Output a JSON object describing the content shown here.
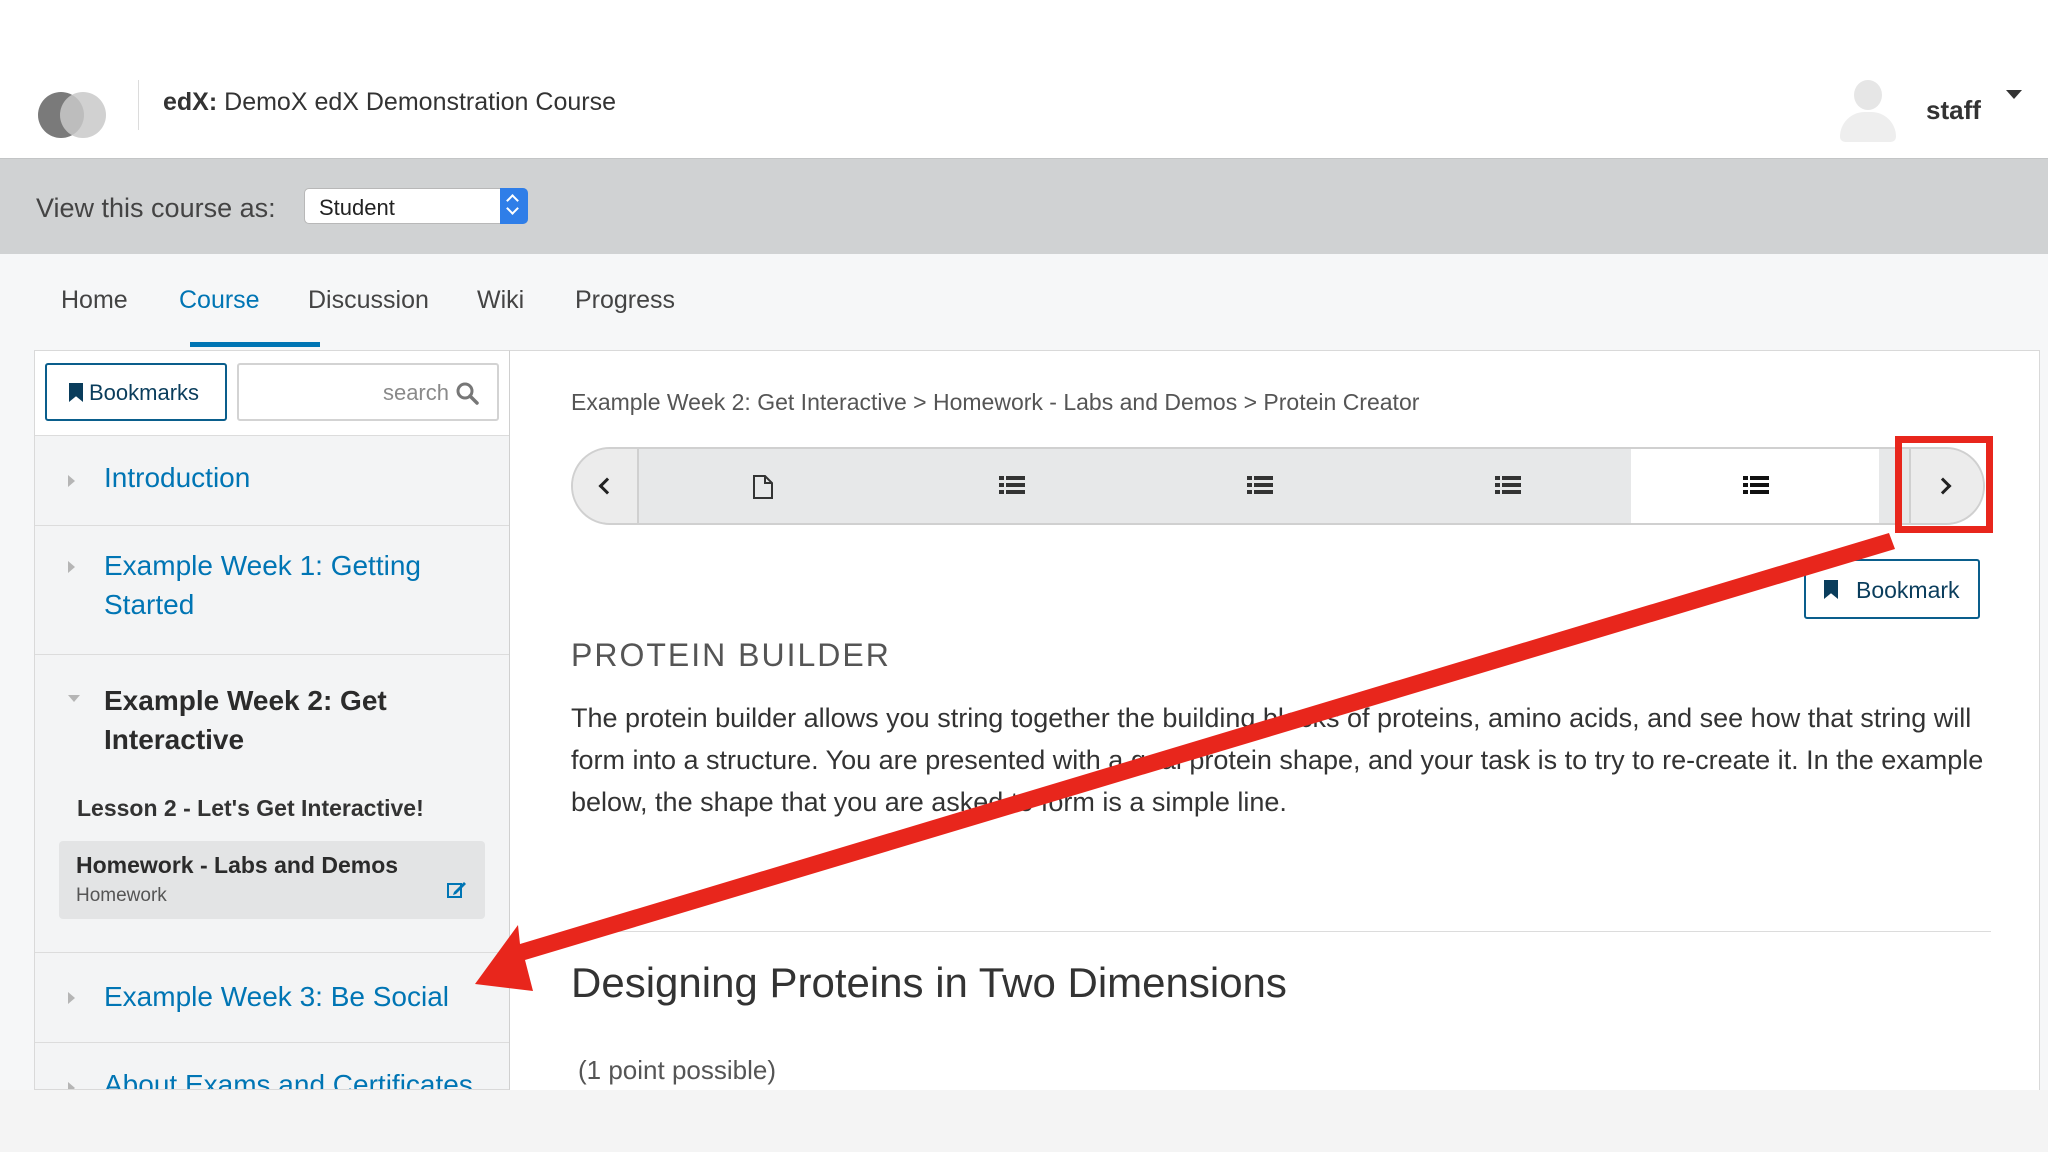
{
  "header": {
    "course_org": "edX:",
    "course_name": "DemoX edX Demonstration Course",
    "username": "staff"
  },
  "staff_bar": {
    "label": "View this course as:",
    "selected_role": "Student"
  },
  "tabs": [
    {
      "label": "Home"
    },
    {
      "label": "Course"
    },
    {
      "label": "Discussion"
    },
    {
      "label": "Wiki"
    },
    {
      "label": "Progress"
    }
  ],
  "active_tab": "Course",
  "sidebar": {
    "bookmarks_label": "Bookmarks",
    "search_placeholder": "search",
    "sections": [
      {
        "title": "Introduction",
        "expanded": false
      },
      {
        "title": "Example Week 1: Getting Started",
        "expanded": false
      },
      {
        "title": "Example Week 2: Get Interactive",
        "expanded": true
      },
      {
        "title": "Example Week 3: Be Social",
        "expanded": false
      },
      {
        "title": "About Exams and Certificates",
        "expanded": false
      }
    ],
    "lesson_title": "Lesson 2 - Let's Get Interactive!",
    "active_subsection": {
      "title": "Homework - Labs and Demos",
      "subtitle": "Homework"
    }
  },
  "main": {
    "breadcrumb": "Example Week 2: Get Interactive > Homework - Labs and Demos > Protein Creator",
    "sequence_units": [
      {
        "icon": "document-icon",
        "active": false
      },
      {
        "icon": "list-icon",
        "active": false
      },
      {
        "icon": "list-icon",
        "active": false
      },
      {
        "icon": "list-icon",
        "active": false
      },
      {
        "icon": "list-icon",
        "active": true
      }
    ],
    "bookmark_label": "Bookmark",
    "heading": "PROTEIN BUILDER",
    "body": "The protein builder allows you string together the building blocks of proteins, amino acids, and see how that string will form into a structure. You are presented with a goal protein shape, and your task is to try to re-create it. In the example below, the shape that you are asked to form is a simple line.",
    "problem_title": "Designing Proteins in Two Dimensions",
    "points": "(1 point possible)"
  },
  "colors": {
    "link": "#0075b4",
    "annotation": "#e8261c",
    "staff_bar": "#d0d2d3",
    "select_accent": "#2f7ee8"
  }
}
